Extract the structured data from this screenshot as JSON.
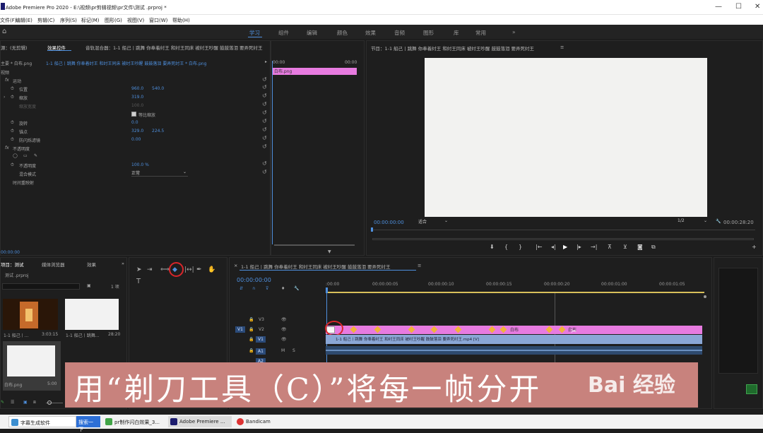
{
  "titlebar": {
    "title": "Adobe Premiere Pro 2020 - E:\\视频\\pr剪辑视频\\pr文件\\测试 .prproj *",
    "minimize": "—",
    "maximize": "☐",
    "close": "✕"
  },
  "menu": [
    "文件(F)",
    "编辑(E)",
    "剪辑(C)",
    "序列(S)",
    "标记(M)",
    "图形(G)",
    "视图(V)",
    "窗口(W)",
    "帮助(H)"
  ],
  "workspaces": [
    "学习",
    "组件",
    "编辑",
    "颜色",
    "效果",
    "音频",
    "图形",
    "库",
    "常用",
    "»"
  ],
  "effect_controls": {
    "tabs": [
      "源：(无剪辑)",
      "效果控件",
      "音轨混合器：1-1 船己丨跳舞 你奉着纣王 和纣王同床 被纣王吵醒 鼓鼓落泪 要弄死纣王"
    ],
    "source": "主要 * 白布.png",
    "sequence": "1-1 船己丨跳舞 你奉着纣王 和纣王同床 被纣王吵醒 鼓鼓落泪 要弄死纣王 * 白布.png",
    "video_label": "视频",
    "motion": "运动",
    "position": {
      "label": "位置",
      "x": "960.0",
      "y": "540.0"
    },
    "scale": {
      "label": "缩放",
      "value": "319.0"
    },
    "scale_width": {
      "label": "缩放宽度",
      "value": "100.0"
    },
    "uniform": "等比缩放",
    "rotation": {
      "label": "旋转",
      "value": "0.0"
    },
    "anchor": {
      "label": "锚点",
      "x": "329.0",
      "y": "224.5"
    },
    "flicker": {
      "label": "防闪烁滤镜",
      "value": "0.00"
    },
    "opacity_group": "不透明度",
    "opacity": {
      "label": "不透明度",
      "value": "100.0 %"
    },
    "blend": {
      "label": "混合模式",
      "value": "正常"
    },
    "remap": "时间重映射",
    "footer_time": "00:00:00"
  },
  "mini_timeline": {
    "t0": "00:00",
    "t1": "00:00",
    "clip": "白布.png"
  },
  "program": {
    "title": "节目：1-1 船己丨跳舞 你奉着纣王 和纣王同床 被纣王吵醒 鼓鼓落泪 要弄死纣王",
    "menu": "≡",
    "timecode": "00:00:00:00",
    "fit": "适合",
    "res": "1/2",
    "duration": "00:00:28:20"
  },
  "project": {
    "tabs": [
      "项目：测试",
      "媒体浏览器",
      "效果"
    ],
    "file": "测试 .prproj",
    "items_count": "1 项",
    "items": [
      {
        "name": "1-1 船己丨...",
        "dur": "3:03:15"
      },
      {
        "name": "1-1 船己丨跳舞...",
        "dur": "28:20"
      },
      {
        "name": "白布.png",
        "dur": "5:00"
      }
    ]
  },
  "timeline": {
    "title": "1-1 船己丨跳舞 你奉着纣王 和纣王同床 被纣王吵醒 鼓鼓落泪 要弄死纣王",
    "timecode": "00:00:00:00",
    "ruler": [
      ":00:00",
      "00:00:00:05",
      "00:00:00:10",
      "00:00:00:15",
      "00:00:00:20",
      "00:00:01:00",
      "00:00:01:05"
    ],
    "tracks": [
      "V3",
      "V2",
      "V1",
      "A1",
      "A2"
    ],
    "v1_clip": "1-1 船己丨跳舞 你奉着纣王 和纣王同床 被纣王吵醒 鼓鼓落泪 要弄死纣王.mp4 [V]",
    "v2_clip": "白布",
    "v2_clip_b": "白布"
  },
  "caption": "用“剃刀工具（C）”将每一帧分开",
  "watermark": "Bai 经验",
  "taskbar": [
    {
      "label": "字幕生成软件"
    },
    {
      "label": "搜索一下"
    },
    {
      "label": "pr制作闪白效果_3..."
    },
    {
      "label": "Adobe Premiere ..."
    },
    {
      "label": "Bandicam"
    }
  ],
  "colors": {
    "accent": "#4e8fdd",
    "clip_pink": "#e77be0",
    "clip_blue": "#8aa7d6",
    "caption_bg": "#c8827d",
    "red_circle": "#d9262b"
  }
}
